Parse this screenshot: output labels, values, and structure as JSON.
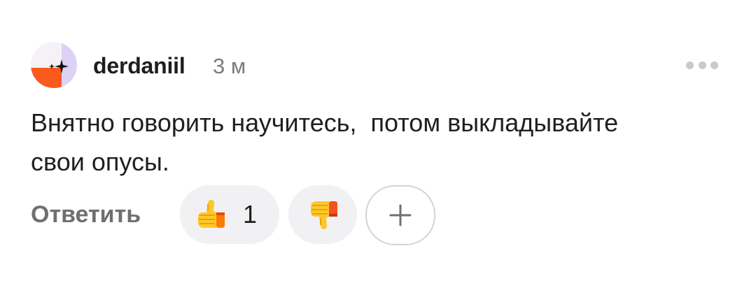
{
  "comment": {
    "author": "derdaniil",
    "time": "3 м",
    "text": "Внятно говорить научитесь,  потом выкладывайте\nсвои опусы.",
    "reply_label": "Ответить",
    "avatar_icon": "avatar-orange-lavender-sparkle",
    "more_icon": "more-dots-icon"
  },
  "reactions": {
    "like": {
      "icon": "thumbs-up-icon",
      "count": "1"
    },
    "dislike": {
      "icon": "thumbs-down-icon"
    },
    "add_icon": "plus-icon"
  },
  "colors": {
    "avatar_orange": "#fa5a1e",
    "avatar_lavender": "#ddd1f6",
    "pill_bg": "#f1f1f3",
    "muted_text": "#6f6f72",
    "time_text": "#7b7b7b"
  }
}
